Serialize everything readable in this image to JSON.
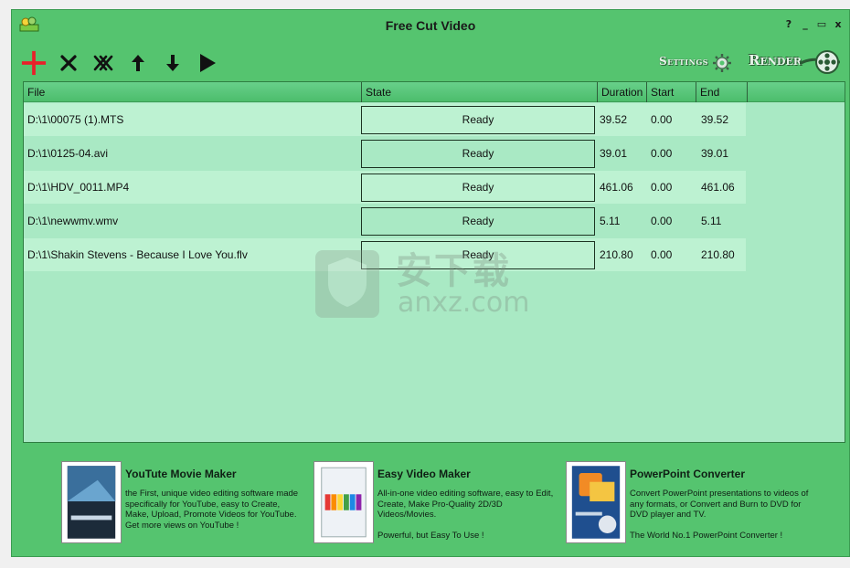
{
  "window": {
    "title": "Free Cut Video",
    "controls": {
      "help": "?",
      "minimize": "_",
      "restore": "▭",
      "close": "x"
    }
  },
  "toolbar": {
    "icons": [
      "plus-icon",
      "remove-icon",
      "remove-all-icon",
      "move-up-icon",
      "move-down-icon",
      "play-icon"
    ],
    "settings_label": "Settings",
    "render_label": "Render"
  },
  "list": {
    "columns": [
      "File",
      "State",
      "Duration",
      "Start",
      "End"
    ],
    "rows": [
      {
        "file": "D:\\1\\00075 (1).MTS",
        "state": "Ready",
        "duration": "39.52",
        "start": "0.00",
        "end": "39.52"
      },
      {
        "file": "D:\\1\\0125-04.avi",
        "state": "Ready",
        "duration": "39.01",
        "start": "0.00",
        "end": "39.01"
      },
      {
        "file": "D:\\1\\HDV_0011.MP4",
        "state": "Ready",
        "duration": "461.06",
        "start": "0.00",
        "end": "461.06"
      },
      {
        "file": "D:\\1\\newwmv.wmv",
        "state": "Ready",
        "duration": "5.11",
        "start": "0.00",
        "end": "5.11"
      },
      {
        "file": "D:\\1\\Shakin Stevens - Because I Love You.flv",
        "state": "Ready",
        "duration": "210.80",
        "start": "0.00",
        "end": "210.80"
      }
    ]
  },
  "watermark": {
    "text_cn": "安下载",
    "text_en": "anxz.com"
  },
  "promos": [
    {
      "title": "YouTute Movie Maker",
      "desc": "the First, unique video editing software made specifically for YouTube, easy to Create, Make, Upload, Promote Videos for YouTube.\nGet more views on YouTube !"
    },
    {
      "title": "Easy Video Maker",
      "desc": "All-in-one video editing software, easy to Edit, Create, Make Pro-Quality 2D/3D Videos/Movies.\n\nPowerful, but Easy To Use !"
    },
    {
      "title": "PowerPoint Converter",
      "desc": "Convert PowerPoint presentations to videos of any formats, or Convert and Burn to DVD for DVD player and TV.\n\nThe World No.1 PowerPoint Converter !"
    }
  ],
  "colors": {
    "window_bg": "#55c46f",
    "list_bg": "#a9e9c4",
    "row_alt": "#bdf2d2",
    "accent_red": "#e8202a"
  }
}
